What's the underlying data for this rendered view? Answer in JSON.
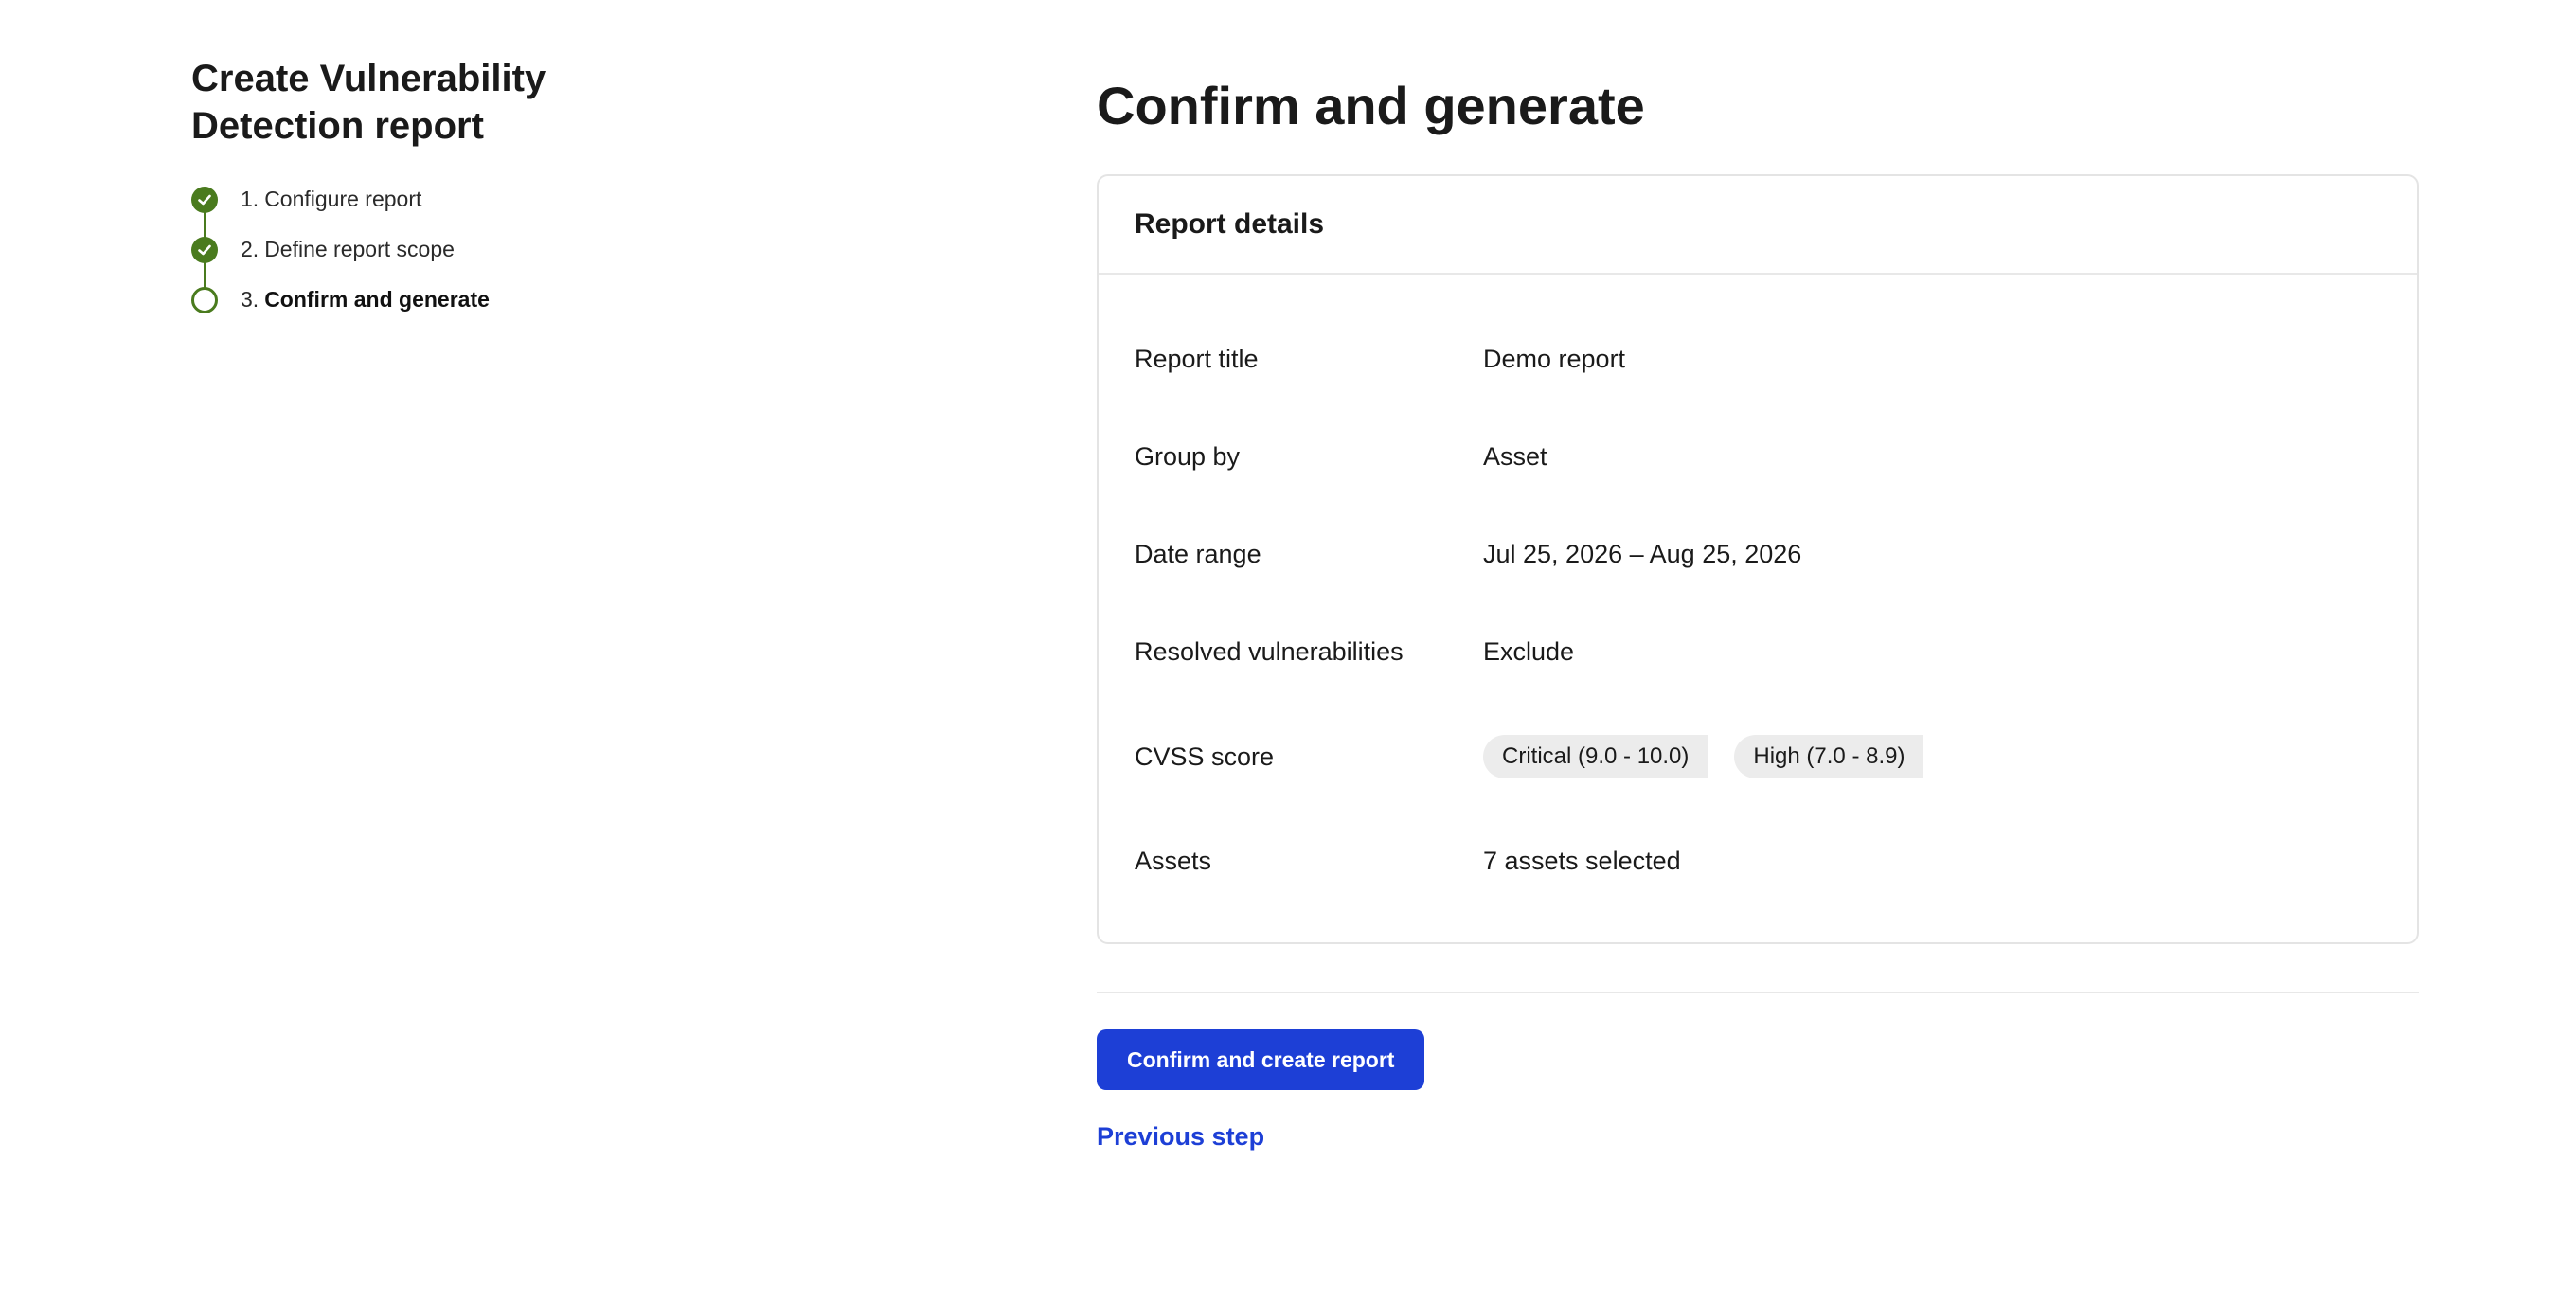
{
  "sidebar": {
    "title_line1": "Create Vulnerability",
    "title_line2": "Detection report",
    "steps": [
      {
        "number": "1.",
        "label": "Configure report",
        "status": "complete"
      },
      {
        "number": "2.",
        "label": "Define report scope",
        "status": "complete"
      },
      {
        "number": "3.",
        "label": "Confirm and generate",
        "status": "current"
      }
    ]
  },
  "main": {
    "title": "Confirm and generate",
    "card": {
      "title": "Report details",
      "rows": [
        {
          "label": "Report title",
          "value": "Demo report"
        },
        {
          "label": "Group by",
          "value": "Asset"
        },
        {
          "label": "Date range",
          "value": "Jul 25, 2026 – Aug 25, 2026"
        },
        {
          "label": "Resolved vulnerabilities",
          "value": "Exclude"
        },
        {
          "label": "CVSS score",
          "tags": [
            "Critical (9.0 - 10.0)",
            "High (7.0 - 8.9)"
          ]
        },
        {
          "label": "Assets",
          "value": "7 assets selected"
        }
      ]
    },
    "confirm_button": "Confirm and create report",
    "previous_link": "Previous step"
  },
  "colors": {
    "accent": "#1d3fd6",
    "step_complete": "#4a7b1e",
    "tag_background": "#ececec"
  },
  "icons": {
    "step_complete": "check-icon"
  }
}
